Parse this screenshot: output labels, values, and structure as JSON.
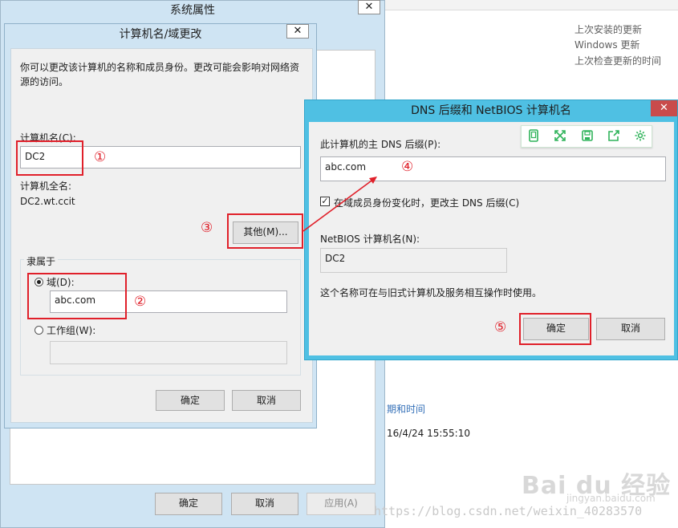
{
  "background": {
    "update_lines": [
      "上次安装的更新",
      "Windows 更新",
      "上次检查更新的时间"
    ],
    "date_time_link": "期和时间",
    "timestamp": "16/4/24 15:55:10"
  },
  "system_properties": {
    "title": "系统属性",
    "ok_label": "确定",
    "cancel_label": "取消",
    "apply_label": "应用(A)"
  },
  "computer_name_dialog": {
    "title": "计算机名/域更改",
    "description": [
      "你可以更改该计算机的名称和成员身份。更改可能会影响对网络资",
      "源的访问。"
    ],
    "computer_name_label": "计算机名(C):",
    "computer_name_value": "DC2",
    "full_name_label": "计算机全名:",
    "full_name_value": "DC2.wt.ccit",
    "more_button": "其他(M)...",
    "member_of_label": "隶属于",
    "domain_label": "域(D):",
    "domain_value": "abc.com",
    "domain_selected": true,
    "workgroup_label": "工作组(W):",
    "workgroup_value": "",
    "ok_label": "确定",
    "cancel_label": "取消"
  },
  "dns_dialog": {
    "title": "DNS 后缀和 NetBIOS 计算机名",
    "primary_suffix_label": "此计算机的主 DNS 后缀(P):",
    "primary_suffix_value": "abc.com",
    "change_suffix_label": "在域成员身份变化时，更改主 DNS 后缀(C)",
    "change_suffix_checked": true,
    "netbios_label": "NetBIOS 计算机名(N):",
    "netbios_value": "DC2",
    "info_text": "这个名称可在与旧式计算机及服务相互操作时使用。",
    "ok_label": "确定",
    "cancel_label": "取消"
  },
  "floating_toolbar": {
    "icons": [
      "phone-icon",
      "expand-icon",
      "save-icon",
      "share-icon",
      "settings-icon"
    ],
    "accent": "#2fb35a"
  },
  "annotations": {
    "step_1": "①",
    "step_2": "②",
    "step_3": "③",
    "step_4": "④",
    "step_5": "⑤",
    "color": "#e0202a"
  },
  "watermark": {
    "url": "https://blog.csdn.net/weixin_40283570",
    "logo_text": "Bai du 经验",
    "logo_sub": "jingyan.baidu.com"
  }
}
